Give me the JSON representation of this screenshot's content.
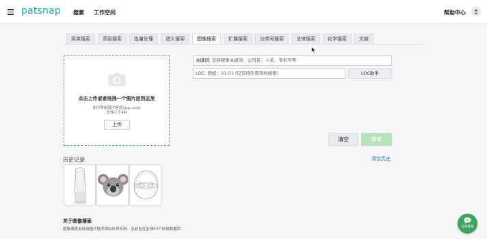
{
  "header": {
    "logo": "patsnap",
    "nav": [
      "搜索",
      "工作空间"
    ],
    "help": "帮助中心"
  },
  "tabs": [
    "简单搜索",
    "高级搜索",
    "批量处理",
    "语义搜索",
    "图像搜索",
    "扩展搜索",
    "分类号搜索",
    "法律搜索",
    "化学搜索",
    "文献"
  ],
  "active_tab": "图像搜索",
  "upload": {
    "title": "点击上传或者拖拽一个图片放到这里",
    "formats": "支持常用图片格式(jpg, png)",
    "size_limit": "文件小于4M",
    "button": "上传"
  },
  "keyword": {
    "label": "关键词:",
    "placeholder": "支持搜索关键词、公司名、人名、专利号等"
  },
  "loc": {
    "label": "LOC:",
    "placeholder": "例如：01-01 (仅支持外观专利搜索)",
    "helper_button": "LOC助手"
  },
  "actions": {
    "clear": "清空",
    "search": "搜索"
  },
  "history": {
    "title": "历史记录",
    "clear": "清空历史",
    "items": [
      "fan-tower-image",
      "koala-image",
      "earbuds-case-image"
    ]
  },
  "about": {
    "title": "关于图像搜索",
    "text": "图像搜索支持用图片搜寻相似外观专利，当前包含全球53个外观数据库："
  },
  "chat": {
    "label": "在线客服"
  },
  "colors": {
    "brand": "#18a8c2",
    "upload_border": "#52b85a",
    "search_button": "#b7e0bc",
    "link": "#1a73c7",
    "chat": "#3fa35e"
  }
}
